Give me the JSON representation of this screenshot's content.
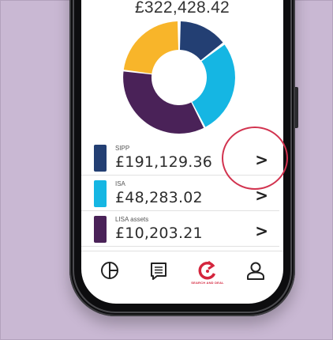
{
  "portfolio": {
    "total": "£322,428.42"
  },
  "chart_data": {
    "type": "pie",
    "categories": [
      "SIPP",
      "ISA",
      "LISA assets"
    ],
    "values": [
      191129.36,
      48283.02,
      10203.21
    ],
    "title": ""
  },
  "accounts": [
    {
      "name": "SIPP",
      "amount": "£191,129.36",
      "color": "#233f73"
    },
    {
      "name": "ISA",
      "amount": "£48,283.02",
      "color": "#15b6e3"
    },
    {
      "name": "LISA assets",
      "amount": "£10,203.21",
      "color": "#4a2258"
    }
  ],
  "chevron_glyph": ">",
  "tabbar": {
    "items": [
      {
        "id": "portfolio",
        "icon": "pie-chart-icon"
      },
      {
        "id": "messages",
        "icon": "message-icon"
      },
      {
        "id": "search-deal",
        "icon": "search-deal-icon",
        "label": "SEARCH AND DEAL",
        "active": true
      },
      {
        "id": "account",
        "icon": "user-icon"
      }
    ]
  },
  "colors": {
    "donut_yellow": "#f8b52a",
    "donut_navy": "#233f73",
    "donut_cyan": "#15b6e3",
    "donut_purple": "#4a2258",
    "accent_red": "#d4253d",
    "background": "#c9b8d3"
  }
}
